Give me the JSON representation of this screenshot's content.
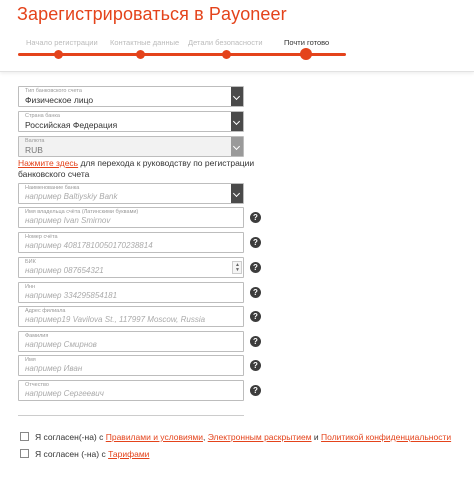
{
  "header": {
    "title_prefix": "Зарегистрироваться в",
    "brand": "Payoneer"
  },
  "steps": [
    {
      "label": "Начало регистрации"
    },
    {
      "label": "Контактные данные"
    },
    {
      "label": "Детали безопасности"
    },
    {
      "label": "Почти готово"
    }
  ],
  "form": {
    "account_type": {
      "label": "Тип банковского счета",
      "value": "Физическое лицо"
    },
    "bank_country": {
      "label": "Страна банка",
      "value": "Российская Федерация"
    },
    "currency": {
      "label": "Валюта",
      "value": "RUB"
    },
    "guide": {
      "link": "Нажмите здесь",
      "text": " для перехода к руководству по регистрации банковского счета"
    },
    "bank_name": {
      "label": "Наименование банка",
      "placeholder": "например Baltiyskiy Bank"
    },
    "holder_name": {
      "label": "Имя владельца счёта (Латинскими буквами)",
      "placeholder": "например Ivan Smirnov"
    },
    "account_number": {
      "label": "Номер счёта",
      "placeholder": "например 40817810050170238814"
    },
    "bik": {
      "label": "БИК",
      "placeholder": "например 087654321"
    },
    "inn": {
      "label": "Инн",
      "placeholder": "например 334295854181"
    },
    "branch_address": {
      "label": "Адрес филиала",
      "placeholder": "например19 Vavilova St., 117997 Moscow, Russia"
    },
    "last_name": {
      "label": "Фамилия",
      "placeholder": "например Смирнов"
    },
    "first_name": {
      "label": "Имя",
      "placeholder": "например Иван"
    },
    "patronymic": {
      "label": "Отчество",
      "placeholder": "например Сергеевич"
    },
    "help_glyph": "?"
  },
  "agreements": {
    "terms": {
      "prefix": "Я согласен(-на) с ",
      "terms_link": "Правилами и условиями",
      "sep1": ", ",
      "edisclosure_link": "Электронным раскрытием",
      "sep2": " и ",
      "privacy_link": "Политикой конфиденциальности"
    },
    "tariffs": {
      "prefix": "Я согласен (-на) с ",
      "tariffs_link": "Тарифами"
    }
  },
  "colors": {
    "accent": "#e4431b",
    "select_button": "#4a4a4a",
    "help_icon": "#3c3c3c"
  }
}
